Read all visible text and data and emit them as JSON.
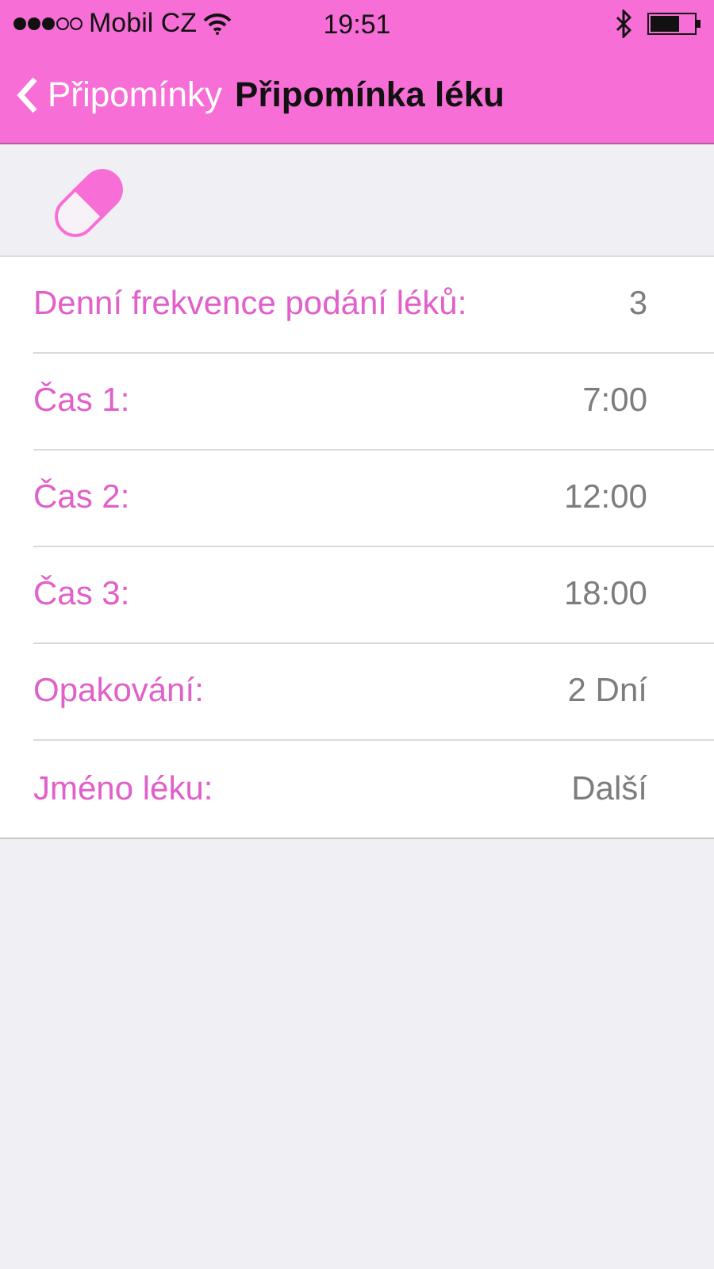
{
  "status_bar": {
    "carrier": "Mobil CZ",
    "time": "19:51"
  },
  "nav": {
    "back": "Připomínky",
    "title": "Připomínka léku"
  },
  "rows": [
    {
      "label": "Denní frekvence podání léků:",
      "value": "3"
    },
    {
      "label": "Čas 1:",
      "value": "7:00"
    },
    {
      "label": "Čas 2:",
      "value": "12:00"
    },
    {
      "label": "Čas 3:",
      "value": "18:00"
    },
    {
      "label": "Opakování:",
      "value": "2 Dní"
    },
    {
      "label": "Jméno léku:",
      "value": "Další"
    }
  ]
}
